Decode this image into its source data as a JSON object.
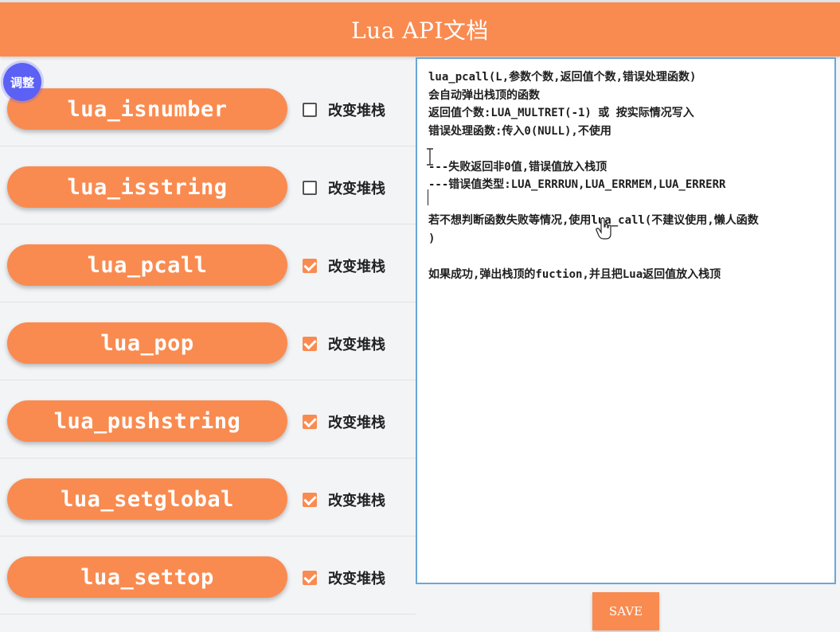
{
  "header": {
    "title": "Lua API文档"
  },
  "badge": {
    "label": "调整"
  },
  "checkbox_label": "改变堆栈",
  "api_list": [
    {
      "name": "lua_isnumber",
      "changes_stack": false
    },
    {
      "name": "lua_isstring",
      "changes_stack": false
    },
    {
      "name": "lua_pcall",
      "changes_stack": true
    },
    {
      "name": "lua_pop",
      "changes_stack": true
    },
    {
      "name": "lua_pushstring",
      "changes_stack": true
    },
    {
      "name": "lua_setglobal",
      "changes_stack": true
    },
    {
      "name": "lua_settop",
      "changes_stack": true
    }
  ],
  "doc": {
    "lines": [
      "lua_pcall(L,参数个数,返回值个数,错误处理函数)",
      "会自动弹出栈顶的函数",
      "返回值个数:LUA_MULTRET(-1) 或 按实际情况写入",
      "错误处理函数:传入0(NULL),不使用",
      "",
      "---失败返回非0值,错误值放入栈顶",
      "---错误值类型:LUA_ERRRUN,LUA_ERRMEM,LUA_ERRERR",
      "",
      "若不想判断函数失败等情况,使用lua_call(不建议使用,懒人函数",
      ")",
      "",
      "如果成功,弹出栈顶的fuction,并且把Lua返回值放入栈顶"
    ]
  },
  "save": {
    "label": "SAVE"
  },
  "colors": {
    "accent": "#f98b50",
    "badge": "#5b61f5",
    "border": "#6aa6d8"
  }
}
